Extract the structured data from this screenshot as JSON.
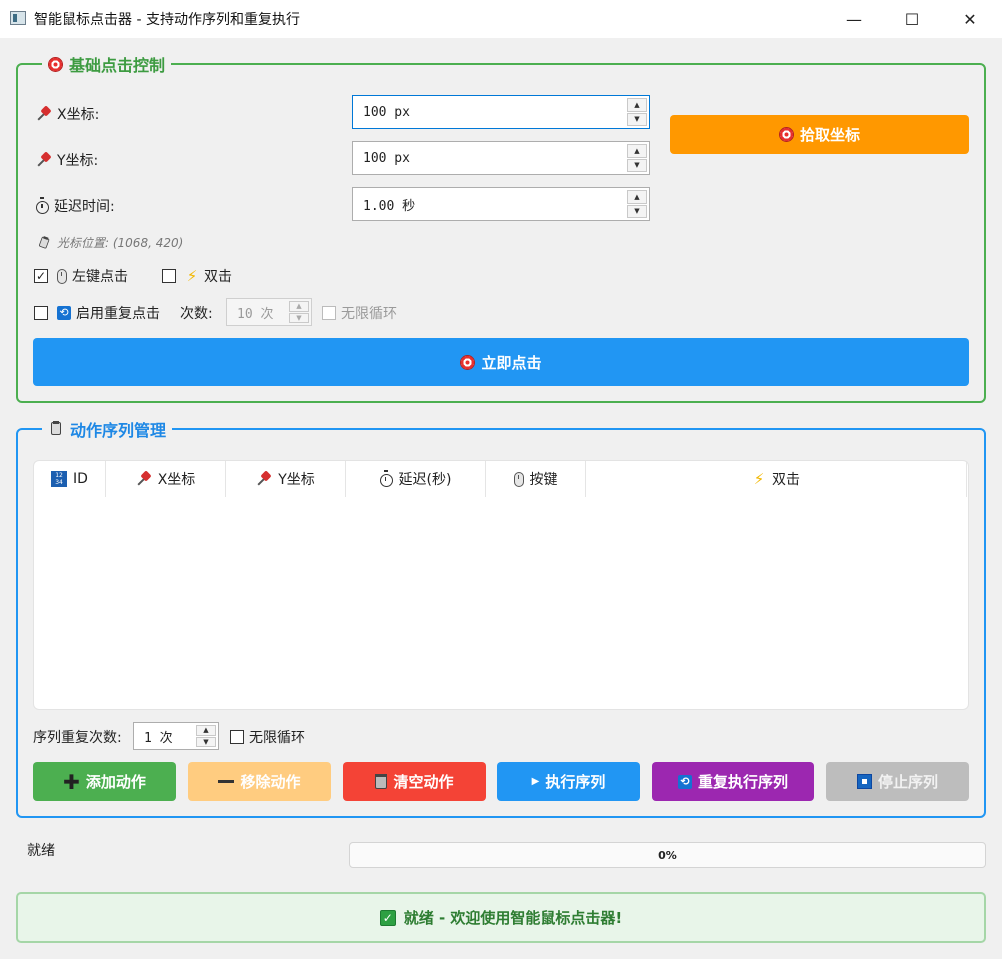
{
  "window": {
    "title": "智能鼠标点击器 - 支持动作序列和重复执行",
    "minimize": "—",
    "maximize": "☐",
    "close": "✕"
  },
  "basic": {
    "legend": "基础点击控制",
    "x_label": "X坐标:",
    "x_value": "100 px",
    "y_label": "Y坐标:",
    "y_value": "100 px",
    "delay_label": "延迟时间:",
    "delay_value": "1.00 秒",
    "pick_button": "拾取坐标",
    "cursor_pos": "光标位置: (1068, 420)",
    "left_click": {
      "label": "左键点击",
      "checked": true
    },
    "double_click": {
      "label": "双击",
      "checked": false
    },
    "repeat": {
      "label": "启用重复点击",
      "checked": false
    },
    "count_label": "次数:",
    "count_value": "10 次",
    "infinite": {
      "label": "无限循环",
      "checked": false
    },
    "click_now": "立即点击"
  },
  "sequence": {
    "legend": "动作序列管理",
    "columns": [
      {
        "label": "ID",
        "icon": "id-icon"
      },
      {
        "label": "X坐标",
        "icon": "pin-icon"
      },
      {
        "label": "Y坐标",
        "icon": "pin-icon"
      },
      {
        "label": "延迟(秒)",
        "icon": "stopwatch-icon"
      },
      {
        "label": "按键",
        "icon": "mouse-icon"
      },
      {
        "label": "双击",
        "icon": "lightning-icon"
      }
    ],
    "rows": [],
    "repeat_label": "序列重复次数:",
    "repeat_value": "1 次",
    "infinite_label": "无限循环",
    "buttons": {
      "add": "添加动作",
      "remove": "移除动作",
      "clear": "清空动作",
      "run": "执行序列",
      "repeat_run": "重复执行序列",
      "stop": "停止序列"
    }
  },
  "status": {
    "text": "就绪",
    "progress_text": "0%",
    "progress": 0,
    "banner": "就绪 - 欢迎使用智能鼠标点击器!"
  },
  "colors": {
    "basic_border": "#4caf50",
    "sequence_border": "#2196f3",
    "pick": "#ff9800",
    "click_now": "#2196f3",
    "add": "#4caf50",
    "remove": "#ffcc80",
    "clear": "#f44336",
    "run": "#2196f3",
    "repeat_run": "#9c27b0",
    "stop": "#bdbdbd",
    "banner_bg": "#e8f5e9",
    "banner_text": "#2e7d32"
  }
}
